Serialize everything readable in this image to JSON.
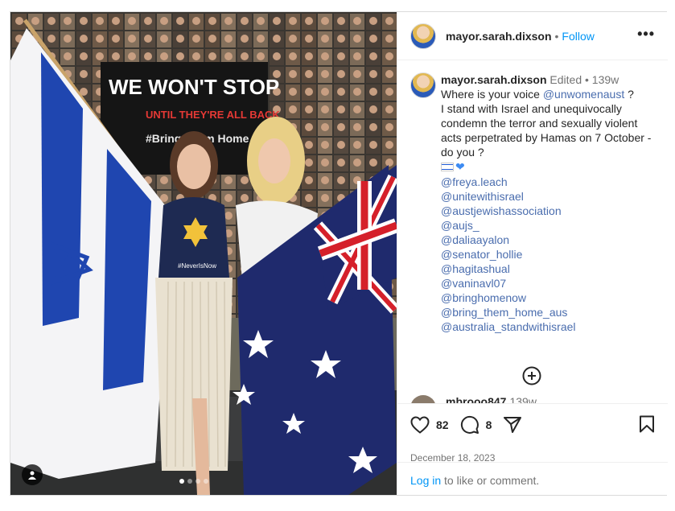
{
  "post": {
    "username": "mayor.sarah.dixson",
    "separator": "•",
    "follow_label": "Follow",
    "more_label": "•••"
  },
  "photo": {
    "banner_line1": "WE WON'T STOP",
    "banner_line2": "UNTIL THEY'RE ALL BACK",
    "banner_line3": "#Bring Them Home Now",
    "shirt_text": "#NeverIsNow",
    "carousel_count": 4,
    "carousel_active": 1
  },
  "caption": {
    "username": "mayor.sarah.dixson",
    "edited_label": "Edited",
    "separator": "•",
    "age": "139w",
    "text_before_mention": "Where is your voice ",
    "mention": "@unwomenaust",
    "text_after_mention": " ?",
    "body": "I stand with Israel and unequivocally condemn the terror and sexually violent acts perpetrated by Hamas on 7 October - do you ?",
    "emoji": "🇮🇱💙",
    "tags": [
      "@freya.leach",
      "@unitewithisrael",
      "@austjewishassociation",
      "@aujs_",
      "@daliaayalon",
      "@senator_hollie",
      "@hagitashual",
      "@vaninavl07",
      "@bringhomenow",
      "@bring_them_home_aus",
      "@australia_standwithisrael"
    ]
  },
  "next_comment": {
    "username": "mbrooo847",
    "age": "139w"
  },
  "actions": {
    "likes": "82",
    "comments": "8"
  },
  "date": "December 18, 2023",
  "login": {
    "link_label": "Log in",
    "rest": " to like or comment."
  },
  "colors": {
    "link_blue": "#0095f6",
    "mention_blue": "#4a6dae",
    "muted_gray": "#737373",
    "text_dark": "#262626",
    "border": "#dbdbdb"
  },
  "icons": [
    "heart-icon",
    "comment-icon",
    "share-icon",
    "bookmark-icon",
    "add-comment-icon",
    "more-icon",
    "user-tag-icon"
  ]
}
